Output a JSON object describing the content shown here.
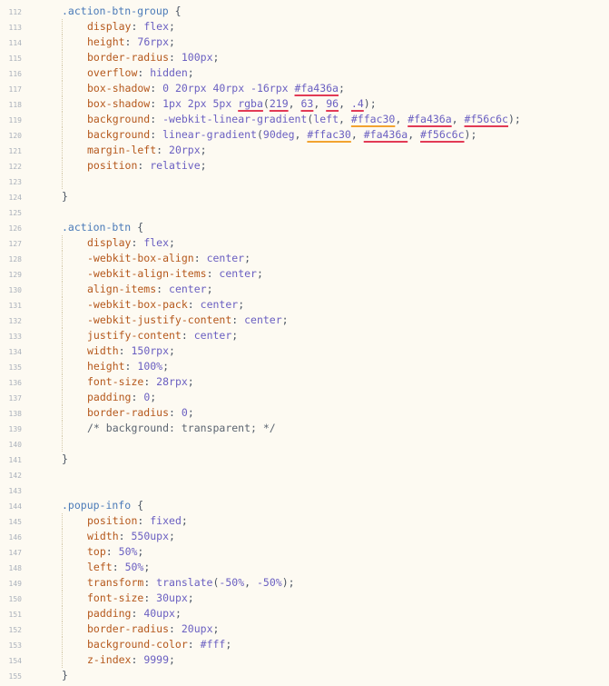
{
  "editor": {
    "lines": [
      {
        "n": "112",
        "tokens": [
          {
            "t": ".action-btn-group",
            "c": "sel"
          },
          {
            "t": " {",
            "c": "pun"
          }
        ]
      },
      {
        "n": "113",
        "indent": 1,
        "tokens": [
          {
            "t": "display",
            "c": "prop"
          },
          {
            "t": ": ",
            "c": "pun"
          },
          {
            "t": "flex",
            "c": "val"
          },
          {
            "t": ";",
            "c": "pun"
          }
        ]
      },
      {
        "n": "114",
        "indent": 1,
        "tokens": [
          {
            "t": "height",
            "c": "prop"
          },
          {
            "t": ": ",
            "c": "pun"
          },
          {
            "t": "76rpx",
            "c": "val"
          },
          {
            "t": ";",
            "c": "pun"
          }
        ]
      },
      {
        "n": "115",
        "indent": 1,
        "tokens": [
          {
            "t": "border-radius",
            "c": "prop"
          },
          {
            "t": ": ",
            "c": "pun"
          },
          {
            "t": "100px",
            "c": "val"
          },
          {
            "t": ";",
            "c": "pun"
          }
        ]
      },
      {
        "n": "116",
        "indent": 1,
        "tokens": [
          {
            "t": "overflow",
            "c": "prop"
          },
          {
            "t": ": ",
            "c": "pun"
          },
          {
            "t": "hidden",
            "c": "val"
          },
          {
            "t": ";",
            "c": "pun"
          }
        ]
      },
      {
        "n": "117",
        "indent": 1,
        "tokens": [
          {
            "t": "box-shadow",
            "c": "prop"
          },
          {
            "t": ": ",
            "c": "pun"
          },
          {
            "t": "0 20rpx 40rpx -16rpx ",
            "c": "val"
          },
          {
            "t": "#fa436a",
            "c": "val",
            "s": "#fa436a"
          },
          {
            "t": ";",
            "c": "pun"
          }
        ]
      },
      {
        "n": "118",
        "indent": 1,
        "tokens": [
          {
            "t": "box-shadow",
            "c": "prop"
          },
          {
            "t": ": ",
            "c": "pun"
          },
          {
            "t": "1px 2px 5px ",
            "c": "val"
          },
          {
            "t": "rgba",
            "c": "fn",
            "s": "#db3f60"
          },
          {
            "t": "(",
            "c": "pun"
          },
          {
            "t": "219",
            "c": "val",
            "s": "#db3f60"
          },
          {
            "t": ", ",
            "c": "pun"
          },
          {
            "t": "63",
            "c": "val",
            "s": "#db3f60"
          },
          {
            "t": ", ",
            "c": "pun"
          },
          {
            "t": "96",
            "c": "val",
            "s": "#db3f60"
          },
          {
            "t": ", ",
            "c": "pun"
          },
          {
            "t": ".4",
            "c": "val",
            "s": "#db3f60"
          },
          {
            "t": ");",
            "c": "pun"
          }
        ]
      },
      {
        "n": "119",
        "indent": 1,
        "tokens": [
          {
            "t": "background",
            "c": "prop"
          },
          {
            "t": ": ",
            "c": "pun"
          },
          {
            "t": "-webkit-linear-gradient",
            "c": "val"
          },
          {
            "t": "(",
            "c": "pun"
          },
          {
            "t": "left",
            "c": "val"
          },
          {
            "t": ", ",
            "c": "pun"
          },
          {
            "t": "#ffac30",
            "c": "val",
            "s": "#ffac30"
          },
          {
            "t": ", ",
            "c": "pun"
          },
          {
            "t": "#fa436a",
            "c": "val",
            "s": "#fa436a"
          },
          {
            "t": ", ",
            "c": "pun"
          },
          {
            "t": "#f56c6c",
            "c": "val",
            "s": "#f56c6c"
          },
          {
            "t": ");",
            "c": "pun"
          }
        ]
      },
      {
        "n": "120",
        "indent": 1,
        "tokens": [
          {
            "t": "background",
            "c": "prop"
          },
          {
            "t": ": ",
            "c": "pun"
          },
          {
            "t": "linear-gradient",
            "c": "val"
          },
          {
            "t": "(",
            "c": "pun"
          },
          {
            "t": "90deg",
            "c": "val"
          },
          {
            "t": ", ",
            "c": "pun"
          },
          {
            "t": "#ffac30",
            "c": "val",
            "s": "#ffac30"
          },
          {
            "t": ", ",
            "c": "pun"
          },
          {
            "t": "#fa436a",
            "c": "val",
            "s": "#fa436a"
          },
          {
            "t": ", ",
            "c": "pun"
          },
          {
            "t": "#f56c6c",
            "c": "val",
            "s": "#f56c6c"
          },
          {
            "t": ");",
            "c": "pun"
          }
        ]
      },
      {
        "n": "121",
        "indent": 1,
        "tokens": [
          {
            "t": "margin-left",
            "c": "prop"
          },
          {
            "t": ": ",
            "c": "pun"
          },
          {
            "t": "20rpx",
            "c": "val"
          },
          {
            "t": ";",
            "c": "pun"
          }
        ]
      },
      {
        "n": "122",
        "indent": 1,
        "tokens": [
          {
            "t": "position",
            "c": "prop"
          },
          {
            "t": ": ",
            "c": "pun"
          },
          {
            "t": "relative",
            "c": "val"
          },
          {
            "t": ";",
            "c": "pun"
          }
        ]
      },
      {
        "n": "123",
        "guide": true,
        "tokens": []
      },
      {
        "n": "124",
        "tokens": [
          {
            "t": "}",
            "c": "pun"
          }
        ]
      },
      {
        "n": "125",
        "tokens": []
      },
      {
        "n": "126",
        "tokens": [
          {
            "t": ".action-btn",
            "c": "sel"
          },
          {
            "t": " {",
            "c": "pun"
          }
        ]
      },
      {
        "n": "127",
        "indent": 1,
        "tokens": [
          {
            "t": "display",
            "c": "prop"
          },
          {
            "t": ": ",
            "c": "pun"
          },
          {
            "t": "flex",
            "c": "val"
          },
          {
            "t": ";",
            "c": "pun"
          }
        ]
      },
      {
        "n": "128",
        "indent": 1,
        "tokens": [
          {
            "t": "-webkit-box-align",
            "c": "prop"
          },
          {
            "t": ": ",
            "c": "pun"
          },
          {
            "t": "center",
            "c": "val"
          },
          {
            "t": ";",
            "c": "pun"
          }
        ]
      },
      {
        "n": "129",
        "indent": 1,
        "tokens": [
          {
            "t": "-webkit-align-items",
            "c": "prop"
          },
          {
            "t": ": ",
            "c": "pun"
          },
          {
            "t": "center",
            "c": "val"
          },
          {
            "t": ";",
            "c": "pun"
          }
        ]
      },
      {
        "n": "130",
        "indent": 1,
        "tokens": [
          {
            "t": "align-items",
            "c": "prop"
          },
          {
            "t": ": ",
            "c": "pun"
          },
          {
            "t": "center",
            "c": "val"
          },
          {
            "t": ";",
            "c": "pun"
          }
        ]
      },
      {
        "n": "131",
        "indent": 1,
        "tokens": [
          {
            "t": "-webkit-box-pack",
            "c": "prop"
          },
          {
            "t": ": ",
            "c": "pun"
          },
          {
            "t": "center",
            "c": "val"
          },
          {
            "t": ";",
            "c": "pun"
          }
        ]
      },
      {
        "n": "132",
        "indent": 1,
        "tokens": [
          {
            "t": "-webkit-justify-content",
            "c": "prop"
          },
          {
            "t": ": ",
            "c": "pun"
          },
          {
            "t": "center",
            "c": "val"
          },
          {
            "t": ";",
            "c": "pun"
          }
        ]
      },
      {
        "n": "133",
        "indent": 1,
        "tokens": [
          {
            "t": "justify-content",
            "c": "prop"
          },
          {
            "t": ": ",
            "c": "pun"
          },
          {
            "t": "center",
            "c": "val"
          },
          {
            "t": ";",
            "c": "pun"
          }
        ]
      },
      {
        "n": "134",
        "indent": 1,
        "tokens": [
          {
            "t": "width",
            "c": "prop"
          },
          {
            "t": ": ",
            "c": "pun"
          },
          {
            "t": "150rpx",
            "c": "val"
          },
          {
            "t": ";",
            "c": "pun"
          }
        ]
      },
      {
        "n": "135",
        "indent": 1,
        "tokens": [
          {
            "t": "height",
            "c": "prop"
          },
          {
            "t": ": ",
            "c": "pun"
          },
          {
            "t": "100%",
            "c": "val"
          },
          {
            "t": ";",
            "c": "pun"
          }
        ]
      },
      {
        "n": "136",
        "indent": 1,
        "tokens": [
          {
            "t": "font-size",
            "c": "prop"
          },
          {
            "t": ": ",
            "c": "pun"
          },
          {
            "t": "28rpx",
            "c": "val"
          },
          {
            "t": ";",
            "c": "pun"
          }
        ]
      },
      {
        "n": "137",
        "indent": 1,
        "tokens": [
          {
            "t": "padding",
            "c": "prop"
          },
          {
            "t": ": ",
            "c": "pun"
          },
          {
            "t": "0",
            "c": "val"
          },
          {
            "t": ";",
            "c": "pun"
          }
        ]
      },
      {
        "n": "138",
        "indent": 1,
        "tokens": [
          {
            "t": "border-radius",
            "c": "prop"
          },
          {
            "t": ": ",
            "c": "pun"
          },
          {
            "t": "0",
            "c": "val"
          },
          {
            "t": ";",
            "c": "pun"
          }
        ]
      },
      {
        "n": "139",
        "indent": 1,
        "tokens": [
          {
            "t": "/* background: transparent; */",
            "c": "cmt"
          }
        ]
      },
      {
        "n": "140",
        "guide": true,
        "tokens": []
      },
      {
        "n": "141",
        "tokens": [
          {
            "t": "}",
            "c": "pun"
          }
        ]
      },
      {
        "n": "142",
        "tokens": []
      },
      {
        "n": "143",
        "tokens": []
      },
      {
        "n": "144",
        "tokens": [
          {
            "t": ".popup-info",
            "c": "sel"
          },
          {
            "t": " {",
            "c": "pun"
          }
        ]
      },
      {
        "n": "145",
        "indent": 1,
        "tokens": [
          {
            "t": "position",
            "c": "prop"
          },
          {
            "t": ": ",
            "c": "pun"
          },
          {
            "t": "fixed",
            "c": "val"
          },
          {
            "t": ";",
            "c": "pun"
          }
        ]
      },
      {
        "n": "146",
        "indent": 1,
        "tokens": [
          {
            "t": "width",
            "c": "prop"
          },
          {
            "t": ": ",
            "c": "pun"
          },
          {
            "t": "550upx",
            "c": "val"
          },
          {
            "t": ";",
            "c": "pun"
          }
        ]
      },
      {
        "n": "147",
        "indent": 1,
        "tokens": [
          {
            "t": "top",
            "c": "prop"
          },
          {
            "t": ": ",
            "c": "pun"
          },
          {
            "t": "50%",
            "c": "val"
          },
          {
            "t": ";",
            "c": "pun"
          }
        ]
      },
      {
        "n": "148",
        "indent": 1,
        "tokens": [
          {
            "t": "left",
            "c": "prop"
          },
          {
            "t": ": ",
            "c": "pun"
          },
          {
            "t": "50%",
            "c": "val"
          },
          {
            "t": ";",
            "c": "pun"
          }
        ]
      },
      {
        "n": "149",
        "indent": 1,
        "tokens": [
          {
            "t": "transform",
            "c": "prop"
          },
          {
            "t": ": ",
            "c": "pun"
          },
          {
            "t": "translate",
            "c": "val"
          },
          {
            "t": "(",
            "c": "pun"
          },
          {
            "t": "-50%",
            "c": "val"
          },
          {
            "t": ", ",
            "c": "pun"
          },
          {
            "t": "-50%",
            "c": "val"
          },
          {
            "t": ");",
            "c": "pun"
          }
        ]
      },
      {
        "n": "150",
        "indent": 1,
        "tokens": [
          {
            "t": "font-size",
            "c": "prop"
          },
          {
            "t": ": ",
            "c": "pun"
          },
          {
            "t": "30upx",
            "c": "val"
          },
          {
            "t": ";",
            "c": "pun"
          }
        ]
      },
      {
        "n": "151",
        "indent": 1,
        "tokens": [
          {
            "t": "padding",
            "c": "prop"
          },
          {
            "t": ": ",
            "c": "pun"
          },
          {
            "t": "40upx",
            "c": "val"
          },
          {
            "t": ";",
            "c": "pun"
          }
        ]
      },
      {
        "n": "152",
        "indent": 1,
        "tokens": [
          {
            "t": "border-radius",
            "c": "prop"
          },
          {
            "t": ": ",
            "c": "pun"
          },
          {
            "t": "20upx",
            "c": "val"
          },
          {
            "t": ";",
            "c": "pun"
          }
        ]
      },
      {
        "n": "153",
        "indent": 1,
        "tokens": [
          {
            "t": "background-color",
            "c": "prop"
          },
          {
            "t": ": ",
            "c": "pun"
          },
          {
            "t": "#fff",
            "c": "val"
          },
          {
            "t": ";",
            "c": "pun"
          }
        ]
      },
      {
        "n": "154",
        "indent": 1,
        "tokens": [
          {
            "t": "z-index",
            "c": "prop"
          },
          {
            "t": ": ",
            "c": "pun"
          },
          {
            "t": "9999",
            "c": "val"
          },
          {
            "t": ";",
            "c": "pun"
          }
        ]
      },
      {
        "n": "155",
        "tokens": [
          {
            "t": "}",
            "c": "pun"
          }
        ]
      }
    ]
  }
}
